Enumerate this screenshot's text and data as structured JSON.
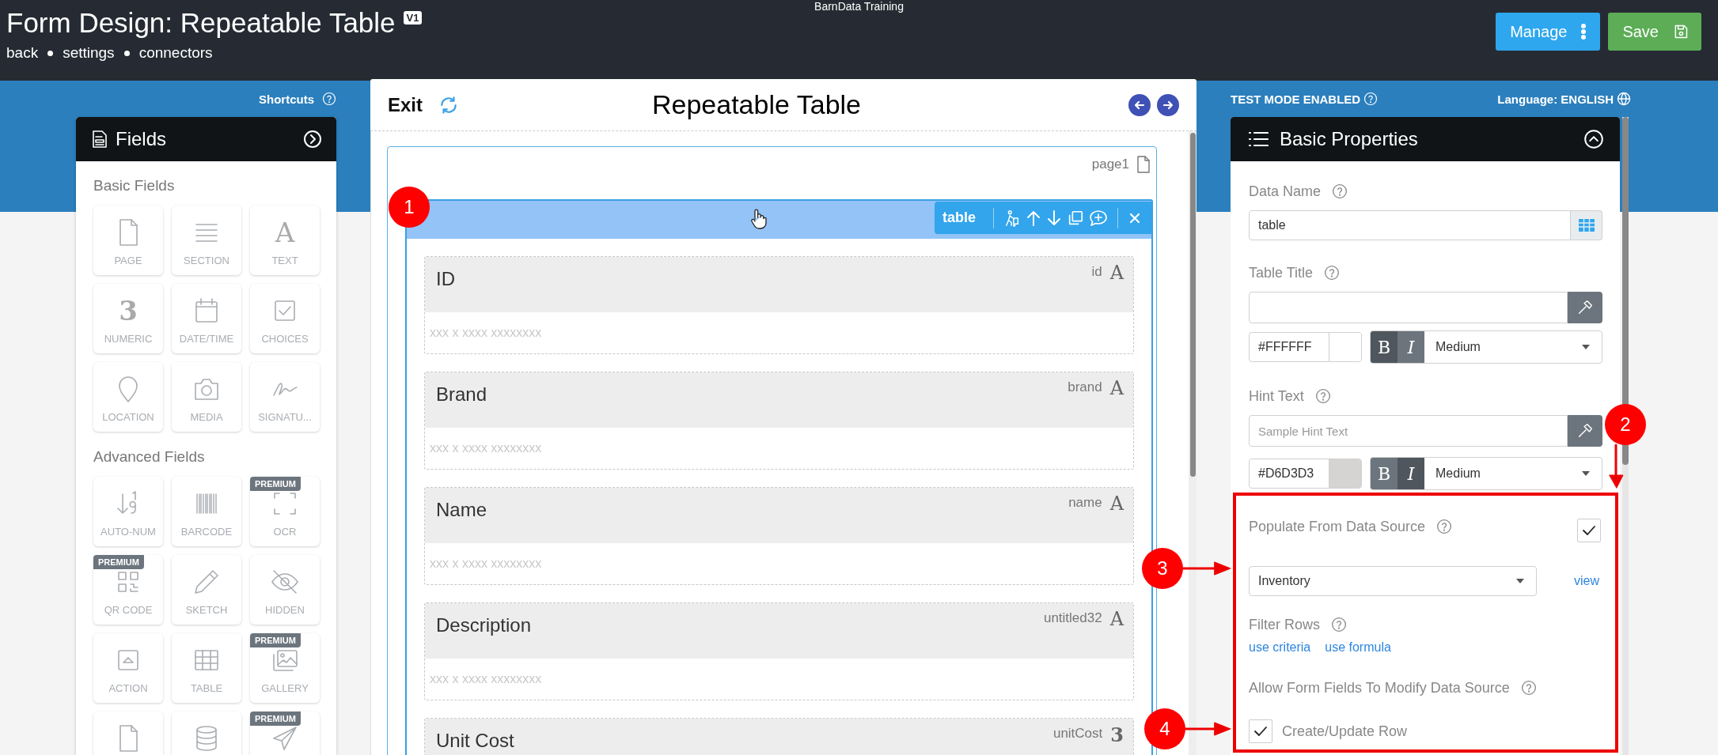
{
  "header": {
    "app_name": "BarnData Training",
    "title": "Form Design: Repeatable Table",
    "version": "V1",
    "nav": [
      "back",
      "settings",
      "connectors"
    ],
    "buttons": [
      {
        "label": "Manage",
        "kind": "menu"
      },
      {
        "label": "Save",
        "kind": "save"
      }
    ]
  },
  "fields_panel": {
    "shortcuts": "Shortcuts",
    "title": "Fields",
    "groups": [
      {
        "title": "Basic Fields",
        "items": [
          {
            "label": "PAGE",
            "kind": "page"
          },
          {
            "label": "SECTION",
            "kind": "section"
          },
          {
            "label": "TEXT",
            "kind": "glyph",
            "glyph": "A"
          },
          {
            "label": "NUMERIC",
            "kind": "glyph",
            "glyph": "3"
          },
          {
            "label": "DATE/TIME",
            "kind": "calendar"
          },
          {
            "label": "CHOICES",
            "kind": "checkbox"
          },
          {
            "label": "LOCATION",
            "kind": "location"
          },
          {
            "label": "MEDIA",
            "kind": "camera"
          },
          {
            "label": "SIGNATU...",
            "kind": "signature"
          }
        ]
      },
      {
        "title": "Advanced Fields",
        "items": [
          {
            "label": "AUTO-NUM",
            "kind": "autonum"
          },
          {
            "label": "BARCODE",
            "kind": "barcode"
          },
          {
            "label": "OCR",
            "kind": "scan",
            "badge": "PREMIUM"
          },
          {
            "label": "QR CODE",
            "kind": "qr",
            "badge": "PREMIUM"
          },
          {
            "label": "SKETCH",
            "kind": "pencil"
          },
          {
            "label": "HIDDEN",
            "kind": "eyeoff"
          },
          {
            "label": "ACTION",
            "kind": "action"
          },
          {
            "label": "TABLE",
            "kind": "table"
          },
          {
            "label": "GALLERY",
            "kind": "gallery",
            "badge": "PREMIUM"
          },
          {
            "kind": "page"
          },
          {
            "kind": "database"
          },
          {
            "kind": "send",
            "badge": "PREMIUM"
          }
        ]
      }
    ]
  },
  "canvas": {
    "exit": "Exit",
    "title": "Repeatable Table",
    "page_name": "page1",
    "table": {
      "toolbar_label": "table",
      "fields": [
        {
          "label": "ID",
          "data_name": "id",
          "glyph": "A",
          "hint": "xxx x xxxx xxxxxxxx"
        },
        {
          "label": "Brand",
          "data_name": "brand",
          "glyph": "A",
          "hint": "xxx x xxxx xxxxxxxx"
        },
        {
          "label": "Name",
          "data_name": "name",
          "glyph": "A",
          "hint": "xxx x xxxx xxxxxxxx"
        },
        {
          "label": "Description",
          "data_name": "untitled32",
          "glyph": "A",
          "hint": "xxx x xxxx xxxxxxxx"
        },
        {
          "label": "Unit Cost",
          "data_name": "unitCost",
          "glyph": "3"
        }
      ]
    }
  },
  "properties": {
    "test_mode": "TEST MODE ENABLED",
    "language": "Language: ENGLISH",
    "title": "Basic Properties",
    "data_name": {
      "label": "Data Name",
      "value": "table"
    },
    "table_title": {
      "label": "Table Title",
      "color_value": "#FFFFFF",
      "toggles": [
        {
          "label": "B",
          "selected": true
        },
        {
          "label": "I",
          "selected": false
        }
      ],
      "size": "Medium"
    },
    "hint_text": {
      "label": "Hint Text",
      "placeholder": "Sample Hint Text",
      "color_value": "#D6D3D3",
      "toggles": [
        {
          "label": "B",
          "selected": false
        },
        {
          "label": "I",
          "selected": true
        }
      ],
      "size": "Medium"
    },
    "populate": {
      "label": "Populate From Data Source",
      "checked": true
    },
    "data_source": {
      "value": "Inventory",
      "link": "view"
    },
    "filter_rows": {
      "label": "Filter Rows",
      "links": [
        "use criteria",
        "use formula"
      ]
    },
    "modify": {
      "label": "Allow Form Fields To Modify Data Source"
    },
    "create_update": {
      "label": "Create/Update Row",
      "checked": true
    }
  },
  "annotations": [
    {
      "label": "1",
      "arrow": false
    },
    {
      "label": "2",
      "arrow": true
    },
    {
      "label": "3",
      "arrow": true
    },
    {
      "label": "4",
      "arrow": true
    }
  ]
}
